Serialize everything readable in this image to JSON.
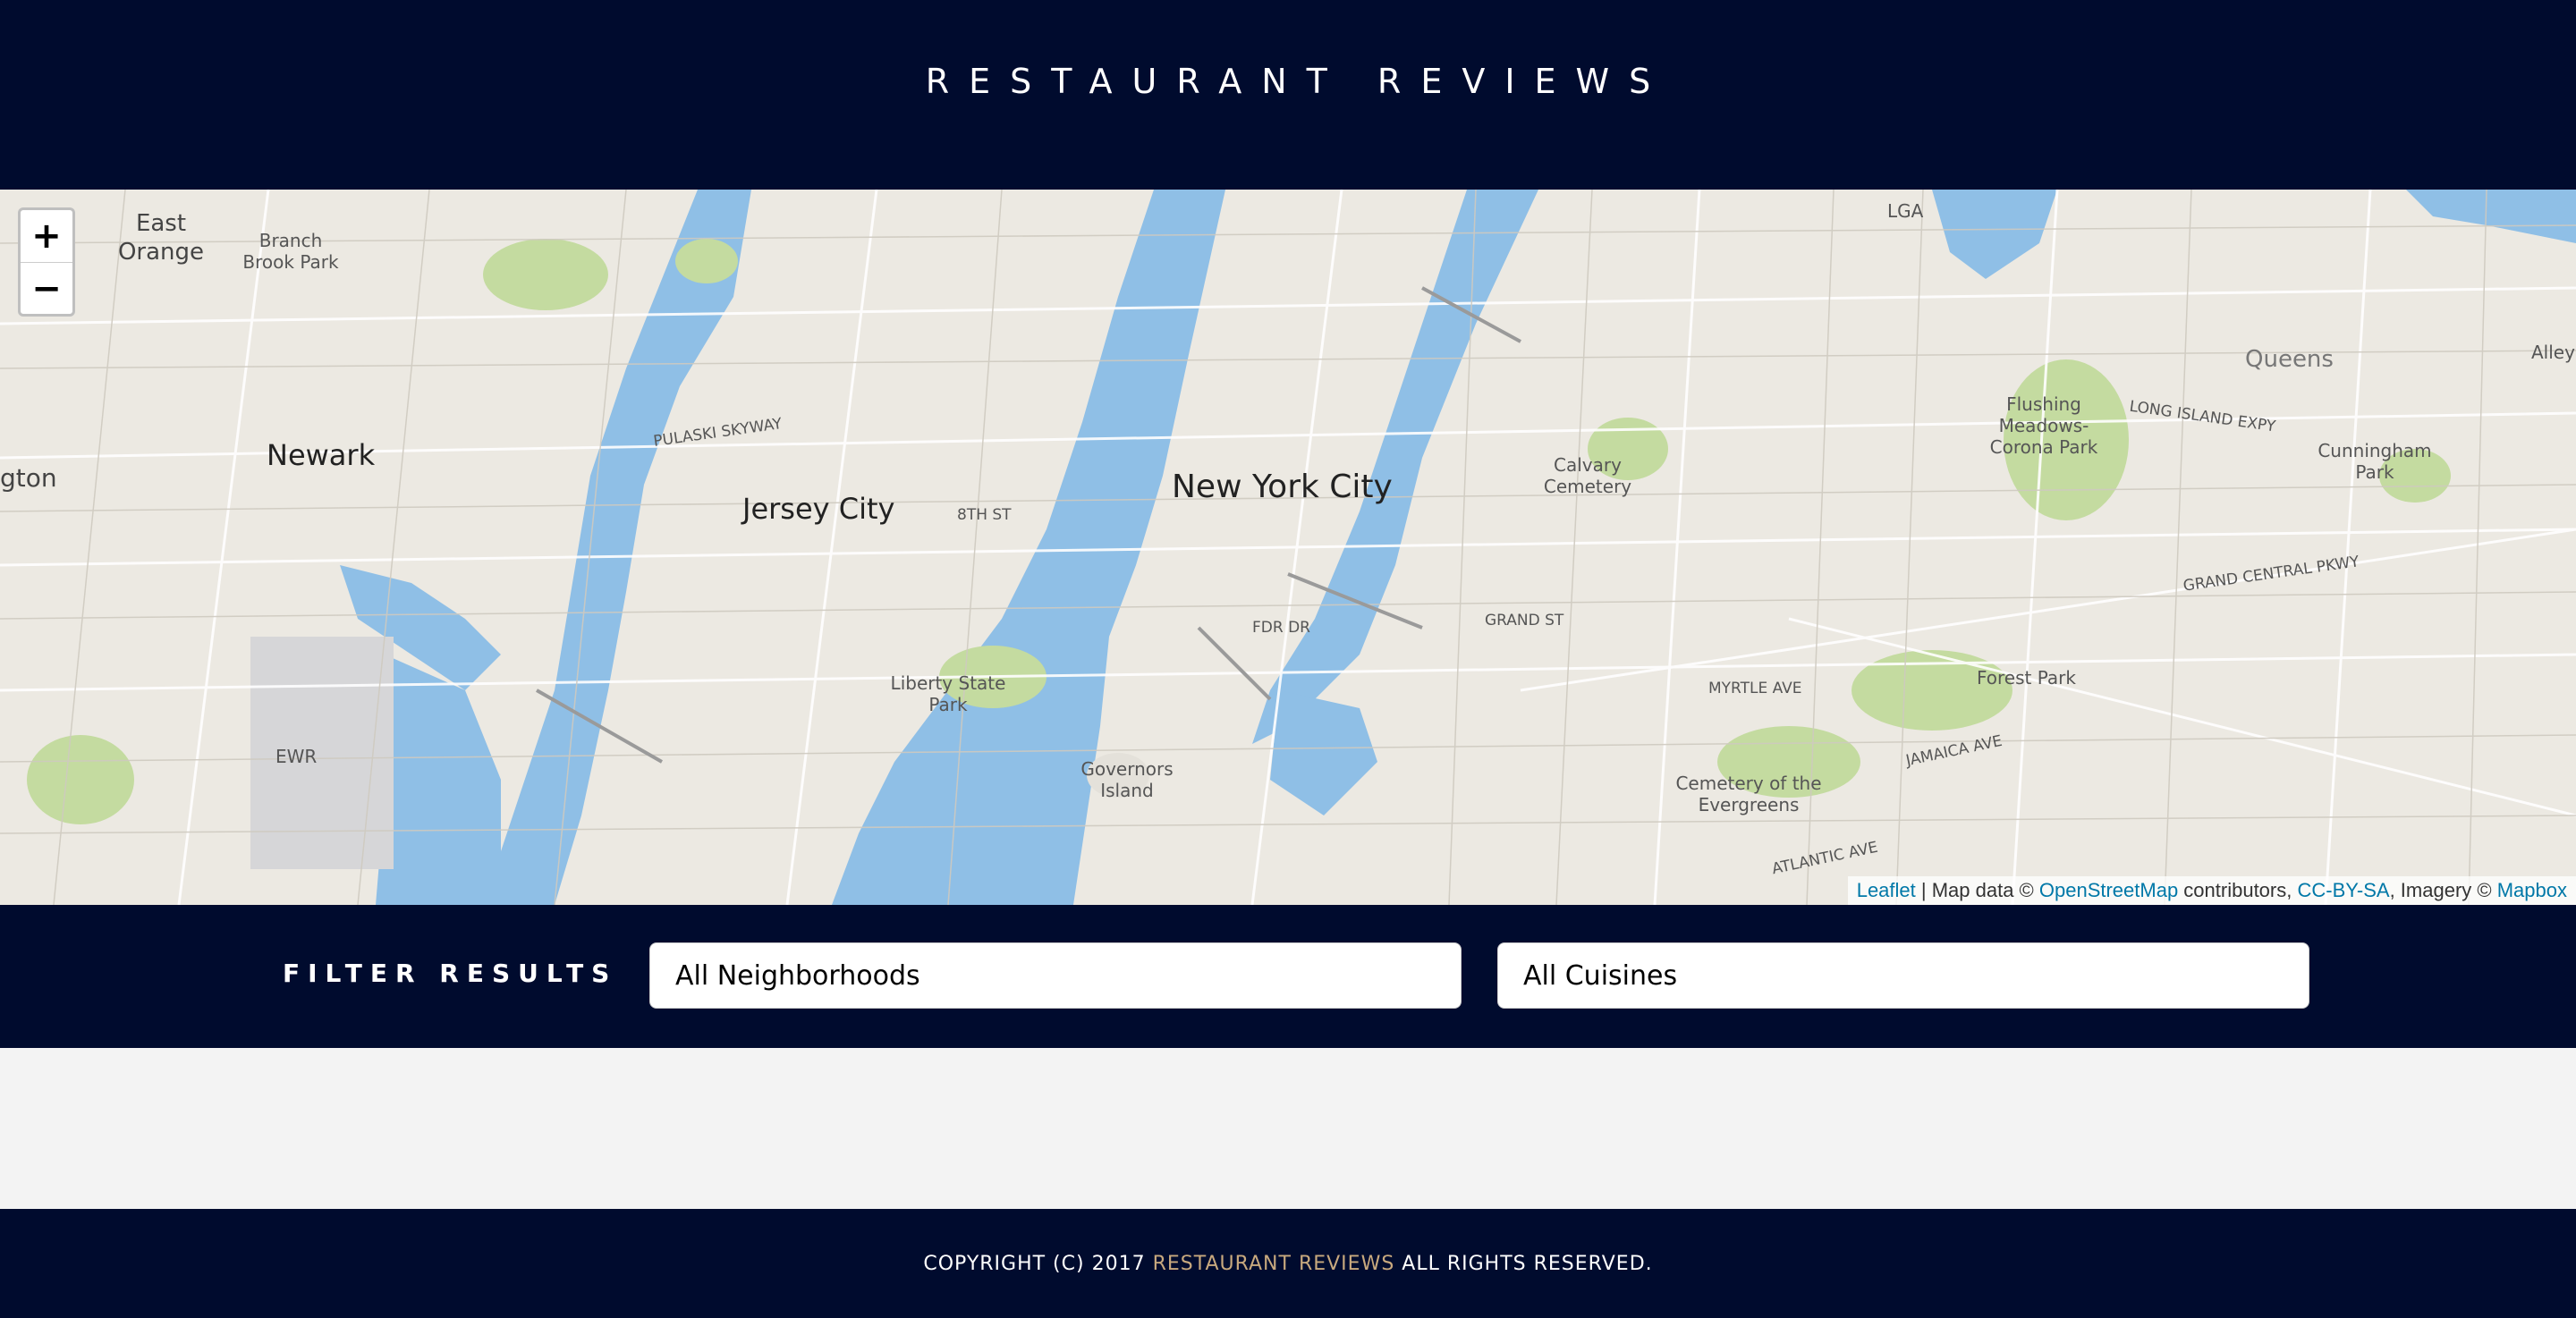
{
  "header": {
    "title": "RESTAURANT REVIEWS"
  },
  "map": {
    "zoom_in_label": "+",
    "zoom_out_label": "−",
    "labels": {
      "nyc": "New York City",
      "jersey_city": "Jersey City",
      "newark": "Newark",
      "east_orange": "East Orange",
      "branch_brook": "Branch Brook Park",
      "queens": "Queens",
      "flushing": "Flushing Meadows-Corona Park",
      "calvary": "Calvary Cemetery",
      "liberty": "Liberty State Park",
      "governors": "Governors Island",
      "forest_park": "Forest Park",
      "evergreens": "Cemetery of the Evergreens",
      "cunningham": "Cunningham Park",
      "lga": "LGA",
      "ewr": "EWR",
      "alley_pond": "Alley Pon",
      "ington": "gton",
      "pulaski": "PULASKI SKYWAY",
      "grand_central": "GRAND CENTRAL PKWY",
      "long_island_expy": "LONG ISLAND EXPY",
      "jamaica_ave": "JAMAICA AVE",
      "atlantic_ave": "ATLANTIC AVE",
      "myrtle_ave": "MYRTLE AVE",
      "grand_st": "GRAND ST",
      "st_8th": "8TH ST",
      "fdr": "FDR DR"
    },
    "attribution": {
      "leaflet": "Leaflet",
      "sep1": " | Map data © ",
      "osm": "OpenStreetMap",
      "sep2": " contributors, ",
      "ccbysa": "CC-BY-SA",
      "sep3": ", Imagery © ",
      "mapbox": "Mapbox"
    }
  },
  "filters": {
    "label": "FILTER RESULTS",
    "neighborhood_selected": "All Neighborhoods",
    "cuisine_selected": "All Cuisines"
  },
  "footer": {
    "prefix": "COPYRIGHT (C) 2017",
    "brand": "RESTAURANT REVIEWS",
    "suffix": "ALL RIGHTS RESERVED."
  },
  "colors": {
    "navy": "#000b2e",
    "water": "#8fbfe6",
    "land": "#ece9e2",
    "park": "#c4dba0",
    "brand_gold": "#c8a97e",
    "link_blue": "#0078a8"
  }
}
